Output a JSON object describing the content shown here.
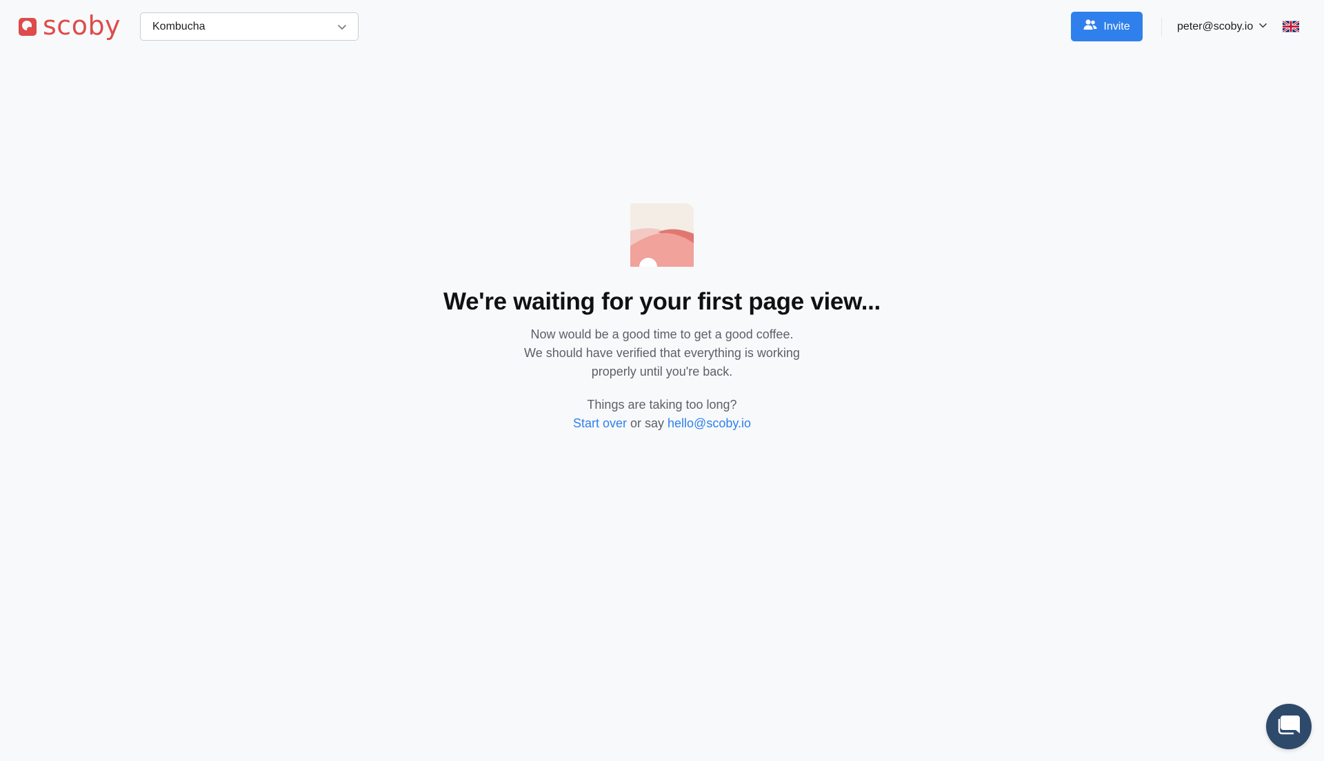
{
  "header": {
    "logo_text": "scoby",
    "site_select": {
      "selected": "Kombucha"
    },
    "invite_label": "Invite",
    "user_email": "peter@scoby.io",
    "language_flag": "uk-flag-icon"
  },
  "main": {
    "illustration": "landscape-illustration",
    "headline": "We're waiting for your first page view...",
    "description_lines": [
      "Now would be a good time to get a good coffee.",
      "We should have verified that everything is working",
      "properly until you're back."
    ],
    "help": {
      "question": "Things are taking too long?",
      "start_over_label": "Start over",
      "or_say_text": " or say ",
      "email_label": "hello@scoby.io"
    }
  },
  "chat_widget": {
    "icon": "chat-bubble-icon"
  },
  "colors": {
    "brand": "#de4b4b",
    "accent": "#2f80ed",
    "chat": "#2e4a6b",
    "background": "#f8f9fb"
  }
}
